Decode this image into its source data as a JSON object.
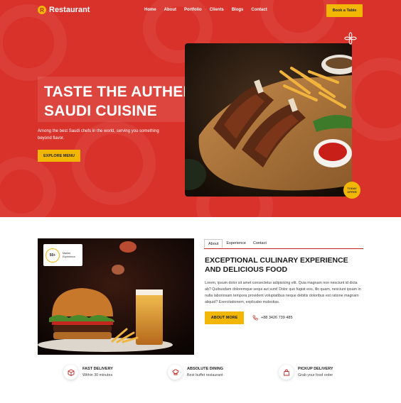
{
  "brand": {
    "logo_mark": "R",
    "name": "Restaurant"
  },
  "nav": {
    "items": [
      "Home",
      "About",
      "Portfolio",
      "Clients",
      "Blogs",
      "Contact"
    ],
    "book_button": "Book a Table"
  },
  "hero": {
    "title_line1": "TASTE THE AUTHENTIC",
    "title_line2": "SAUDI CUISINE",
    "subtitle": "Among the best Saudi chefs in the world, serving you something beyond flavor.",
    "cta": "EXPLORE MENU",
    "badge_line1": "TODAY",
    "badge_line2": "OFFER"
  },
  "about": {
    "experience_number": "50+",
    "experience_label": "Market Experience",
    "tabs": [
      "About",
      "Experience",
      "Contact"
    ],
    "title": "EXCEPTIONAL CULINARY EXPERIENCE AND DELICIOUS FOOD",
    "body": "Lorem, ipsum dolor sit amet consectetur adipisicing elit. Quia magnam non nesciunt id dicta ab? Quibusdam doloremque sequi aut sunt! Dolor quo fugiat eos, illo quam, nesciunt ipsam in nulla laboriosam tempora provident voluptatibus neque debitis doloribus est ratione magnam aliquid? Exercitationem, explicabo molestias.",
    "cta": "ABOUT MORE",
    "phone": "+88 3426 739 485"
  },
  "features": [
    {
      "icon": "box-icon",
      "title": "FAST DELIVERY",
      "subtitle": "Within 30 minutes"
    },
    {
      "icon": "chef-icon",
      "title": "ABSOLUTE DINING",
      "subtitle": "Best buffet restaurant"
    },
    {
      "icon": "bag-icon",
      "title": "PICKUP DELIVERY",
      "subtitle": "Grab your food order"
    }
  ],
  "colors": {
    "hero_red": "#d8322a",
    "accent_yellow": "#f2b705",
    "rule_red": "#c0261f"
  }
}
